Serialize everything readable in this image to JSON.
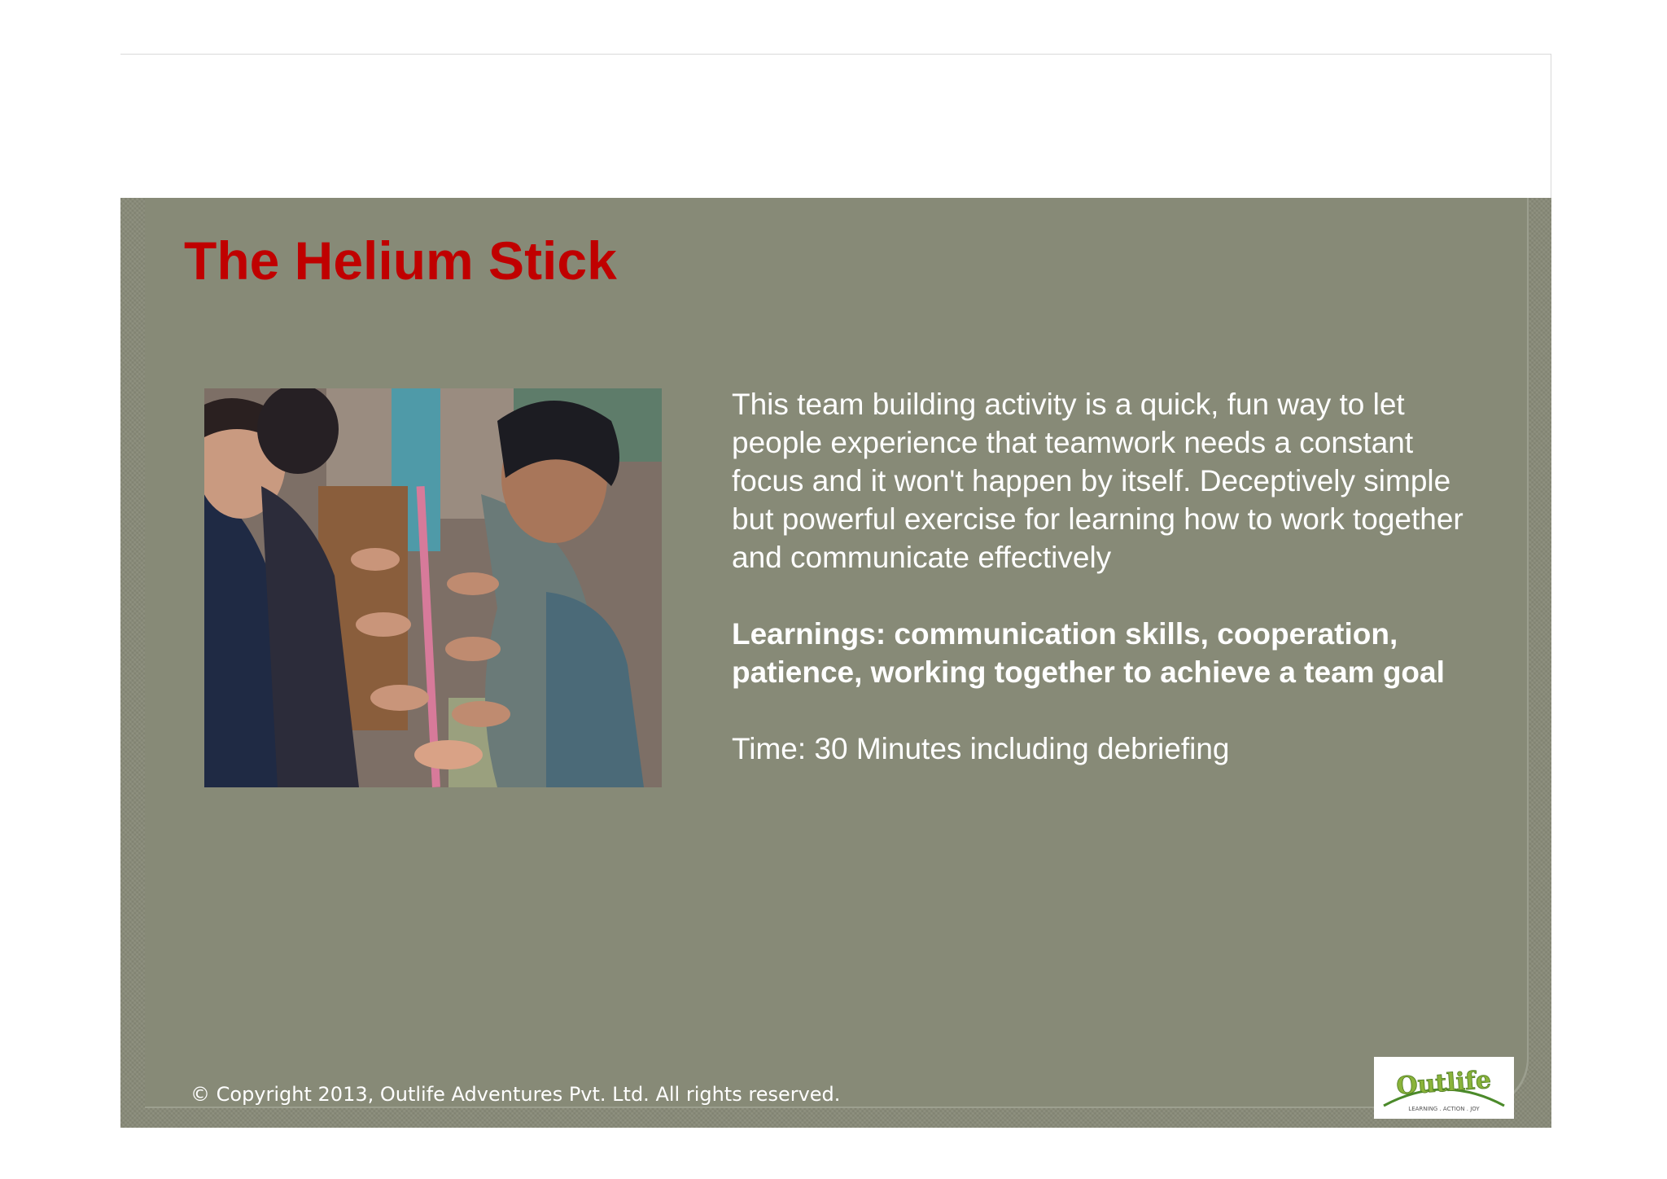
{
  "slide": {
    "title": "The Helium Stick",
    "description": "This team building activity is a quick, fun way to let people experience that teamwork needs a constant focus and it won't happen by itself.  Deceptively simple but powerful exercise for learning how to work together and communicate effectively",
    "learnings": "Learnings:  communication skills, cooperation, patience, working together to achieve a team goal",
    "time": "Time: 30 Minutes including debriefing",
    "footer": "© Copyright 2013, Outlife Adventures Pvt. Ltd. All rights reserved."
  },
  "logo": {
    "name": "Outlife",
    "tagline": "LEARNING . ACTION . JOY"
  },
  "colors": {
    "slide_background": "#878a77",
    "title": "#c00000",
    "body_text": "#ffffff"
  }
}
